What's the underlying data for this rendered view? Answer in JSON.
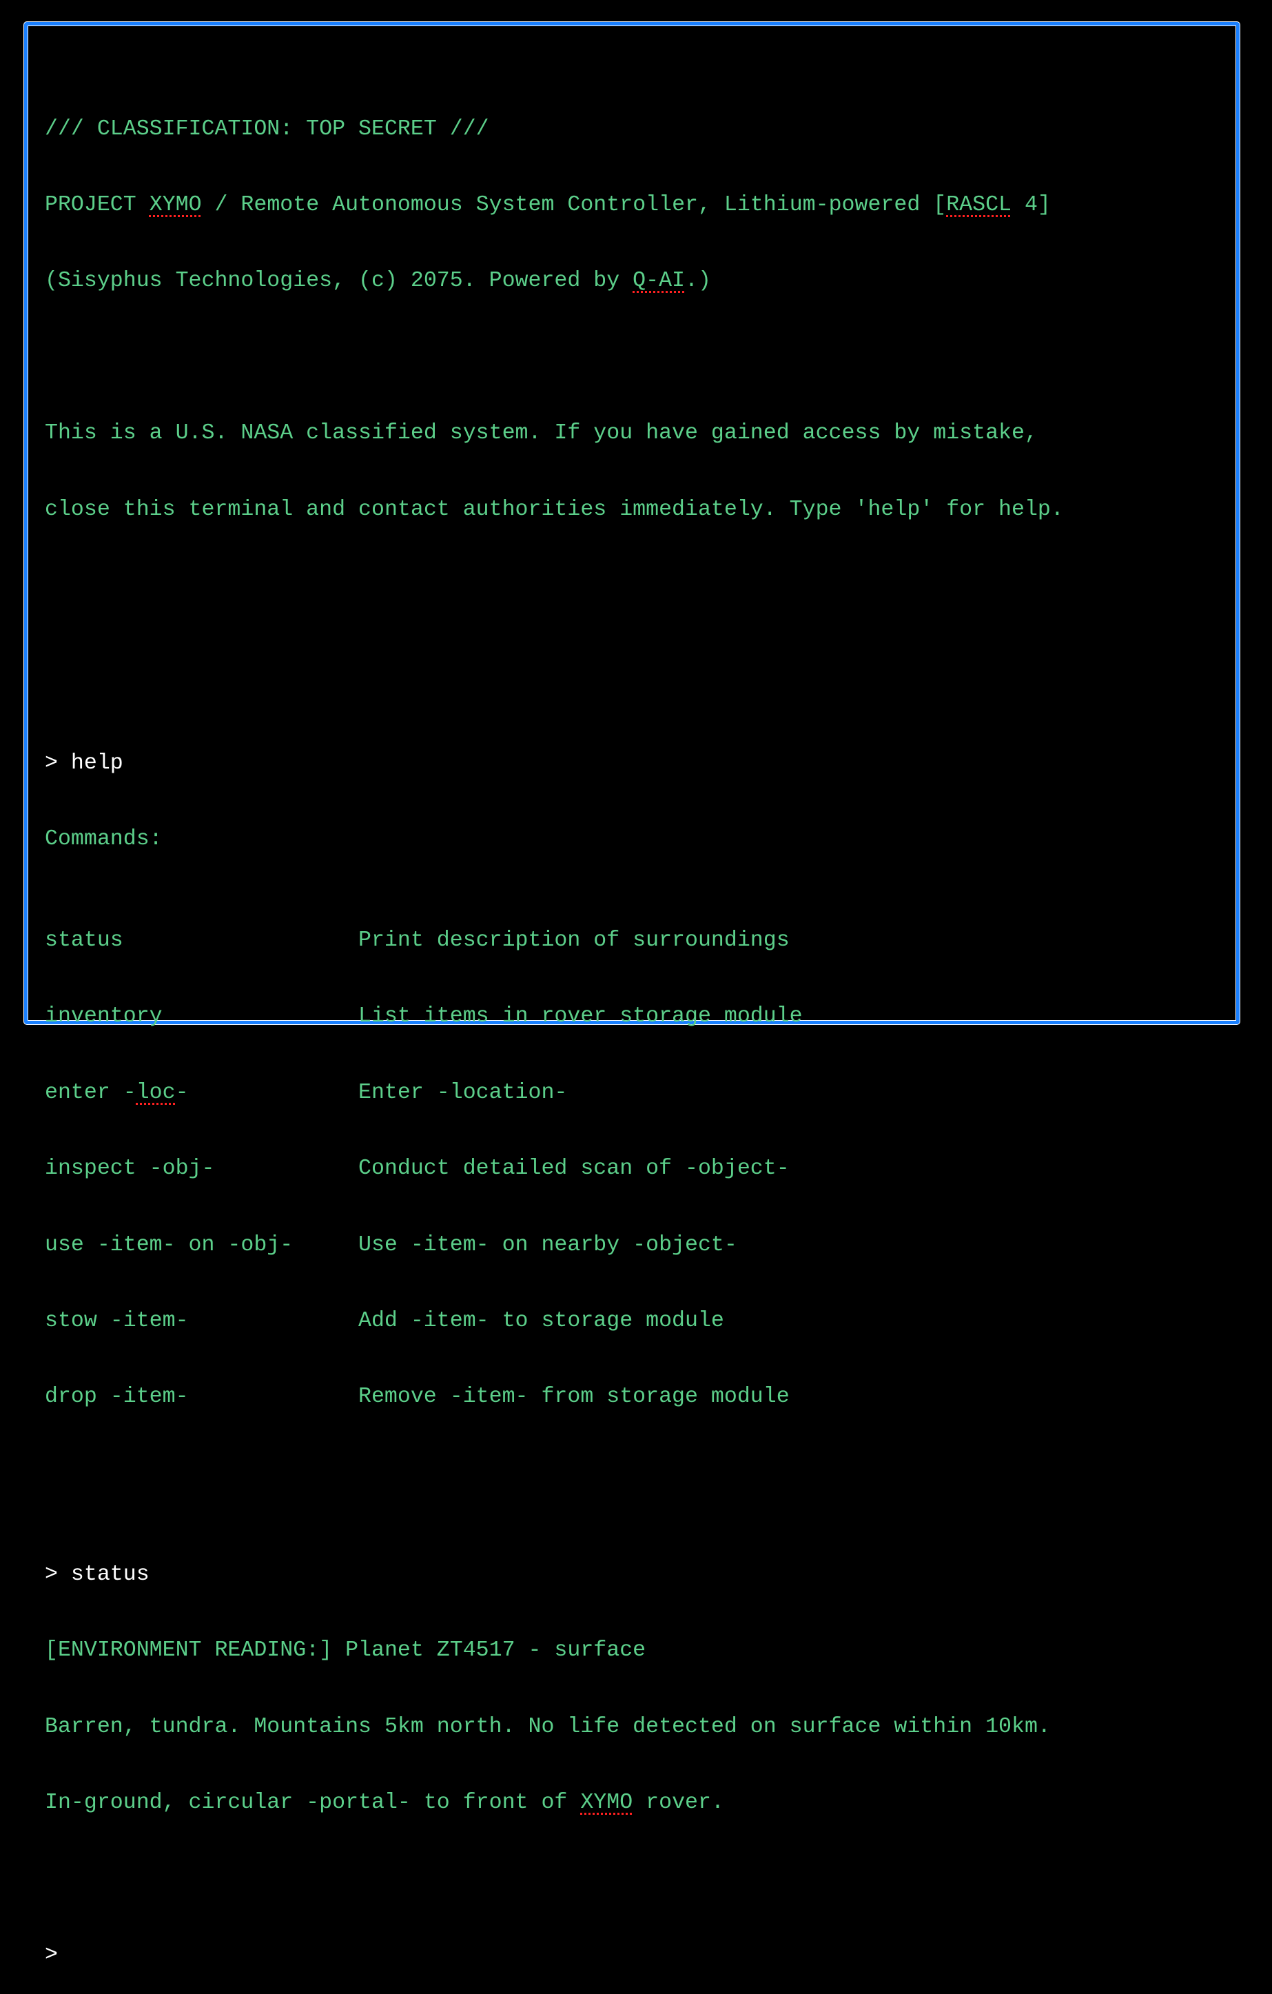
{
  "colors": {
    "text": "#5ccf8a",
    "command": "#ffffff",
    "border": "#1a80ff",
    "spellcheck": "#ff2020",
    "background": "#000000"
  },
  "header": {
    "classification": "/// CLASSIFICATION: TOP SECRET ///",
    "project_prefix": "PROJECT ",
    "project_name": "XYMO",
    "project_mid": " / Remote Autonomous System Controller, Lithium-powered [",
    "project_model": "RASCL",
    "project_suffix": " 4]",
    "credit_prefix": "(Sisyphus Technologies, (c) 2075. Powered by ",
    "credit_ai": "Q-AI",
    "credit_suffix": ".)",
    "warning_line1": "This is a U.S. NASA classified system. If you have gained access by mistake,",
    "warning_line2": "close this terminal and contact authorities immediately. Type 'help' for help."
  },
  "session": {
    "prompt": ">",
    "help_command": "> help",
    "help_title": "Commands:",
    "commands": [
      {
        "name": "status",
        "description": "Print description of surroundings"
      },
      {
        "name": "inventory",
        "description": "List items in rover storage module"
      },
      {
        "name_prefix": "enter -",
        "name_flag": "loc",
        "name_suffix": "-",
        "description": "Enter -location-"
      },
      {
        "name": "inspect -obj-",
        "description": "Conduct detailed scan of -object-"
      },
      {
        "name": "use -item- on -obj-",
        "description": "Use -item- on nearby -object-"
      },
      {
        "name": "stow -item-",
        "description": "Add -item- to storage module"
      },
      {
        "name": "drop -item-",
        "description": "Remove -item- from storage module"
      }
    ],
    "status_command": "> status",
    "status_heading": "[ENVIRONMENT READING:] Planet ZT4517 - surface",
    "status_line1": "Barren, tundra. Mountains 5km north. No life detected on surface within 10km.",
    "status_line2_prefix": "In-ground, circular -portal- to front of ",
    "status_line2_name": "XYMO",
    "status_line2_suffix": " rover.",
    "input_value": ""
  }
}
